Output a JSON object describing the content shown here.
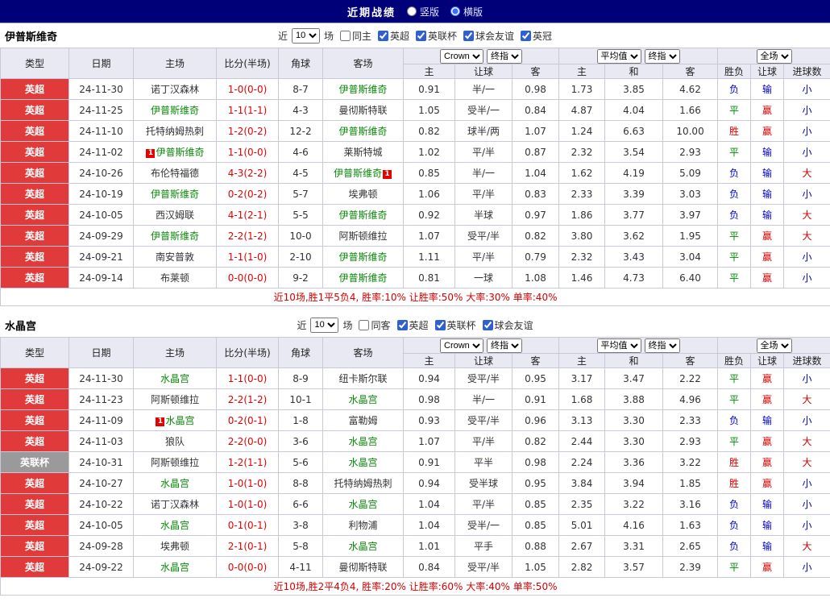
{
  "colors": {
    "topbar_bg": "#000079",
    "epl_red": "#e03a3a",
    "cup_gray": "#9a9a9a",
    "team_green": "#0a8a0a",
    "score_red": "#e60000",
    "summary_red": "#d60000"
  },
  "league_colors": {
    "英超": "#e03a3a",
    "英联杯": "#9a9a9a"
  },
  "result_colors": {
    "胜": "#d40000",
    "赢": "#d40000",
    "大": "#d40000",
    "平": "#008800",
    "负": "#0000cc",
    "输": "#0000cc",
    "小": "#0000cc"
  },
  "red_card_label": "1",
  "top_bar": {
    "title": "近期战绩",
    "radios": [
      {
        "label": "竖版",
        "selected": false
      },
      {
        "label": "横版",
        "selected": true
      }
    ]
  },
  "sections": [
    {
      "team": "伊普斯维奇",
      "filter": {
        "near_label": "近",
        "count": "10",
        "games_label": "场",
        "checkboxes": [
          {
            "label": "同主",
            "checked": false
          },
          {
            "label": "英超",
            "checked": true
          },
          {
            "label": "英联杯",
            "checked": true
          },
          {
            "label": "球会友谊",
            "checked": true
          },
          {
            "label": "英冠",
            "checked": true
          }
        ]
      },
      "header": {
        "cols": [
          "类型",
          "日期",
          "主场",
          "比分(半场)",
          "角球",
          "客场"
        ],
        "book": "Crown",
        "final1": "终指",
        "avg": "平均值",
        "final2": "终指",
        "scope": "全场",
        "sub": [
          "主",
          "让球",
          "客",
          "主",
          "和",
          "客",
          "胜负",
          "让球",
          "进球数"
        ]
      },
      "rows": [
        {
          "league": "英超",
          "date": "24-11-30",
          "home": {
            "name": "诺丁汉森林",
            "hl": false,
            "rc": false
          },
          "score": "1-0(0-0)",
          "corners": "8-7",
          "away": {
            "name": "伊普斯维奇",
            "hl": true,
            "rc": false
          },
          "asia": [
            "0.91",
            "半/一",
            "0.98"
          ],
          "euro": [
            "1.73",
            "3.85",
            "4.62"
          ],
          "res": [
            "负",
            "输",
            "小"
          ]
        },
        {
          "league": "英超",
          "date": "24-11-25",
          "home": {
            "name": "伊普斯维奇",
            "hl": true,
            "rc": false
          },
          "score": "1-1(1-1)",
          "corners": "4-3",
          "away": {
            "name": "曼彻斯特联",
            "hl": false,
            "rc": false
          },
          "asia": [
            "1.05",
            "受半/一",
            "0.84"
          ],
          "euro": [
            "4.87",
            "4.04",
            "1.66"
          ],
          "res": [
            "平",
            "赢",
            "小"
          ]
        },
        {
          "league": "英超",
          "date": "24-11-10",
          "home": {
            "name": "托特纳姆热刺",
            "hl": false,
            "rc": false
          },
          "score": "1-2(0-2)",
          "corners": "12-2",
          "away": {
            "name": "伊普斯维奇",
            "hl": true,
            "rc": false
          },
          "asia": [
            "0.82",
            "球半/两",
            "1.07"
          ],
          "euro": [
            "1.24",
            "6.63",
            "10.00"
          ],
          "res": [
            "胜",
            "赢",
            "小"
          ]
        },
        {
          "league": "英超",
          "date": "24-11-02",
          "home": {
            "name": "伊普斯维奇",
            "hl": true,
            "rc": true
          },
          "score": "1-1(0-0)",
          "corners": "4-6",
          "away": {
            "name": "莱斯特城",
            "hl": false,
            "rc": false
          },
          "asia": [
            "1.02",
            "平/半",
            "0.87"
          ],
          "euro": [
            "2.32",
            "3.54",
            "2.93"
          ],
          "res": [
            "平",
            "输",
            "小"
          ]
        },
        {
          "league": "英超",
          "date": "24-10-26",
          "home": {
            "name": "布伦特福德",
            "hl": false,
            "rc": false
          },
          "score": "4-3(2-2)",
          "corners": "4-5",
          "away": {
            "name": "伊普斯维奇",
            "hl": true,
            "rc": true
          },
          "asia": [
            "0.85",
            "半/一",
            "1.04"
          ],
          "euro": [
            "1.62",
            "4.19",
            "5.09"
          ],
          "res": [
            "负",
            "输",
            "大"
          ]
        },
        {
          "league": "英超",
          "date": "24-10-19",
          "home": {
            "name": "伊普斯维奇",
            "hl": true,
            "rc": false
          },
          "score": "0-2(0-2)",
          "corners": "5-7",
          "away": {
            "name": "埃弗顿",
            "hl": false,
            "rc": false
          },
          "asia": [
            "1.06",
            "平/半",
            "0.83"
          ],
          "euro": [
            "2.33",
            "3.39",
            "3.03"
          ],
          "res": [
            "负",
            "输",
            "小"
          ]
        },
        {
          "league": "英超",
          "date": "24-10-05",
          "home": {
            "name": "西汉姆联",
            "hl": false,
            "rc": false
          },
          "score": "4-1(2-1)",
          "corners": "5-5",
          "away": {
            "name": "伊普斯维奇",
            "hl": true,
            "rc": false
          },
          "asia": [
            "0.92",
            "半球",
            "0.97"
          ],
          "euro": [
            "1.86",
            "3.77",
            "3.97"
          ],
          "res": [
            "负",
            "输",
            "大"
          ]
        },
        {
          "league": "英超",
          "date": "24-09-29",
          "home": {
            "name": "伊普斯维奇",
            "hl": true,
            "rc": false
          },
          "score": "2-2(1-2)",
          "corners": "10-0",
          "away": {
            "name": "阿斯顿维拉",
            "hl": false,
            "rc": false
          },
          "asia": [
            "1.07",
            "受平/半",
            "0.82"
          ],
          "euro": [
            "3.80",
            "3.62",
            "1.95"
          ],
          "res": [
            "平",
            "赢",
            "大"
          ]
        },
        {
          "league": "英超",
          "date": "24-09-21",
          "home": {
            "name": "南安普敦",
            "hl": false,
            "rc": false
          },
          "score": "1-1(1-0)",
          "corners": "2-10",
          "away": {
            "name": "伊普斯维奇",
            "hl": true,
            "rc": false
          },
          "asia": [
            "1.11",
            "平/半",
            "0.79"
          ],
          "euro": [
            "2.32",
            "3.43",
            "3.04"
          ],
          "res": [
            "平",
            "赢",
            "小"
          ]
        },
        {
          "league": "英超",
          "date": "24-09-14",
          "home": {
            "name": "布莱顿",
            "hl": false,
            "rc": false
          },
          "score": "0-0(0-0)",
          "corners": "9-2",
          "away": {
            "name": "伊普斯维奇",
            "hl": true,
            "rc": false
          },
          "asia": [
            "0.81",
            "一球",
            "1.08"
          ],
          "euro": [
            "1.46",
            "4.73",
            "6.40"
          ],
          "res": [
            "平",
            "赢",
            "小"
          ]
        }
      ],
      "summary": "近10场,胜1平5负4, 胜率:10% 让胜率:50% 大率:30% 单率:40%"
    },
    {
      "team": "水晶宫",
      "filter": {
        "near_label": "近",
        "count": "10",
        "games_label": "场",
        "checkboxes": [
          {
            "label": "同客",
            "checked": false
          },
          {
            "label": "英超",
            "checked": true
          },
          {
            "label": "英联杯",
            "checked": true
          },
          {
            "label": "球会友谊",
            "checked": true
          }
        ]
      },
      "header": {
        "cols": [
          "类型",
          "日期",
          "主场",
          "比分(半场)",
          "角球",
          "客场"
        ],
        "book": "Crown",
        "final1": "终指",
        "avg": "平均值",
        "final2": "终指",
        "scope": "全场",
        "sub": [
          "主",
          "让球",
          "客",
          "主",
          "和",
          "客",
          "胜负",
          "让球",
          "进球数"
        ]
      },
      "rows": [
        {
          "league": "英超",
          "date": "24-11-30",
          "home": {
            "name": "水晶宫",
            "hl": true,
            "rc": false
          },
          "score": "1-1(0-0)",
          "corners": "8-9",
          "away": {
            "name": "纽卡斯尔联",
            "hl": false,
            "rc": false
          },
          "asia": [
            "0.94",
            "受平/半",
            "0.95"
          ],
          "euro": [
            "3.17",
            "3.47",
            "2.22"
          ],
          "res": [
            "平",
            "赢",
            "小"
          ]
        },
        {
          "league": "英超",
          "date": "24-11-23",
          "home": {
            "name": "阿斯顿维拉",
            "hl": false,
            "rc": false
          },
          "score": "2-2(1-2)",
          "corners": "10-1",
          "away": {
            "name": "水晶宫",
            "hl": true,
            "rc": false
          },
          "asia": [
            "0.98",
            "半/一",
            "0.91"
          ],
          "euro": [
            "1.68",
            "3.88",
            "4.96"
          ],
          "res": [
            "平",
            "赢",
            "大"
          ]
        },
        {
          "league": "英超",
          "date": "24-11-09",
          "home": {
            "name": "水晶宫",
            "hl": true,
            "rc": true
          },
          "score": "0-2(0-1)",
          "corners": "1-8",
          "away": {
            "name": "富勒姆",
            "hl": false,
            "rc": false
          },
          "asia": [
            "0.93",
            "受平/半",
            "0.96"
          ],
          "euro": [
            "3.13",
            "3.30",
            "2.33"
          ],
          "res": [
            "负",
            "输",
            "小"
          ]
        },
        {
          "league": "英超",
          "date": "24-11-03",
          "home": {
            "name": "狼队",
            "hl": false,
            "rc": false
          },
          "score": "2-2(0-0)",
          "corners": "3-6",
          "away": {
            "name": "水晶宫",
            "hl": true,
            "rc": false
          },
          "asia": [
            "1.07",
            "平/半",
            "0.82"
          ],
          "euro": [
            "2.44",
            "3.30",
            "2.93"
          ],
          "res": [
            "平",
            "赢",
            "大"
          ]
        },
        {
          "league": "英联杯",
          "date": "24-10-31",
          "home": {
            "name": "阿斯顿维拉",
            "hl": false,
            "rc": false
          },
          "score": "1-2(1-1)",
          "corners": "5-6",
          "away": {
            "name": "水晶宫",
            "hl": true,
            "rc": false
          },
          "asia": [
            "0.91",
            "平半",
            "0.98"
          ],
          "euro": [
            "2.24",
            "3.36",
            "3.22"
          ],
          "res": [
            "胜",
            "赢",
            "大"
          ]
        },
        {
          "league": "英超",
          "date": "24-10-27",
          "home": {
            "name": "水晶宫",
            "hl": true,
            "rc": false
          },
          "score": "1-0(1-0)",
          "corners": "8-8",
          "away": {
            "name": "托特纳姆热刺",
            "hl": false,
            "rc": false
          },
          "asia": [
            "0.94",
            "受半球",
            "0.95"
          ],
          "euro": [
            "3.84",
            "3.94",
            "1.85"
          ],
          "res": [
            "胜",
            "赢",
            "小"
          ]
        },
        {
          "league": "英超",
          "date": "24-10-22",
          "home": {
            "name": "诺丁汉森林",
            "hl": false,
            "rc": false
          },
          "score": "1-0(1-0)",
          "corners": "6-6",
          "away": {
            "name": "水晶宫",
            "hl": true,
            "rc": false
          },
          "asia": [
            "1.04",
            "平/半",
            "0.85"
          ],
          "euro": [
            "2.35",
            "3.22",
            "3.16"
          ],
          "res": [
            "负",
            "输",
            "小"
          ]
        },
        {
          "league": "英超",
          "date": "24-10-05",
          "home": {
            "name": "水晶宫",
            "hl": true,
            "rc": false
          },
          "score": "0-1(0-1)",
          "corners": "3-8",
          "away": {
            "name": "利物浦",
            "hl": false,
            "rc": false
          },
          "asia": [
            "1.04",
            "受半/一",
            "0.85"
          ],
          "euro": [
            "5.01",
            "4.16",
            "1.63"
          ],
          "res": [
            "负",
            "输",
            "小"
          ]
        },
        {
          "league": "英超",
          "date": "24-09-28",
          "home": {
            "name": "埃弗顿",
            "hl": false,
            "rc": false
          },
          "score": "2-1(0-1)",
          "corners": "5-8",
          "away": {
            "name": "水晶宫",
            "hl": true,
            "rc": false
          },
          "asia": [
            "1.01",
            "平手",
            "0.88"
          ],
          "euro": [
            "2.67",
            "3.31",
            "2.65"
          ],
          "res": [
            "负",
            "输",
            "大"
          ]
        },
        {
          "league": "英超",
          "date": "24-09-22",
          "home": {
            "name": "水晶宫",
            "hl": true,
            "rc": false
          },
          "score": "0-0(0-0)",
          "corners": "4-11",
          "away": {
            "name": "曼彻斯特联",
            "hl": false,
            "rc": false
          },
          "asia": [
            "0.84",
            "受平/半",
            "1.05"
          ],
          "euro": [
            "2.82",
            "3.57",
            "2.39"
          ],
          "res": [
            "平",
            "赢",
            "小"
          ]
        }
      ],
      "summary": "近10场,胜2平4负4, 胜率:20% 让胜率:60% 大率:40% 单率:50%"
    }
  ]
}
